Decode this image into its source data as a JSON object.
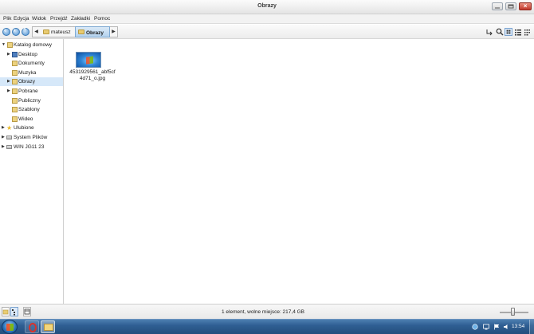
{
  "window": {
    "title": "Obrazy"
  },
  "menubar": [
    "Plik",
    "Edycja",
    "Widok",
    "Przejdź",
    "Zakładki",
    "Pomoc"
  ],
  "breadcrumb": {
    "parent": "mateusz",
    "current": "Obrazy"
  },
  "sidebar": {
    "items": [
      {
        "label": "Katalog domowy",
        "icon": "home-folder-icon",
        "expanded": true
      },
      {
        "label": "Desktop",
        "icon": "desktop-folder-icon",
        "expanded": false
      },
      {
        "label": "Dokumenty",
        "icon": "folder-icon"
      },
      {
        "label": "Muzyka",
        "icon": "folder-icon"
      },
      {
        "label": "Obrazy",
        "icon": "folder-icon",
        "selected": true,
        "expanded": false
      },
      {
        "label": "Pobrane",
        "icon": "folder-icon",
        "expanded": false
      },
      {
        "label": "Publiczny",
        "icon": "folder-icon"
      },
      {
        "label": "Szablony",
        "icon": "folder-icon"
      },
      {
        "label": "Wideo",
        "icon": "folder-icon"
      },
      {
        "label": "Ulubione",
        "icon": "star-icon",
        "expanded": false
      },
      {
        "label": "System Plików",
        "icon": "drive-icon",
        "expanded": false
      },
      {
        "label": "WIN JG11 23",
        "icon": "drive-icon",
        "expanded": false
      }
    ]
  },
  "files": [
    {
      "name": "4531929561_abf5cf4d71_o.jpg",
      "icon": "image-thumbnail"
    }
  ],
  "status": {
    "text": "1 element, wolne miejsce: 217,4 GB"
  },
  "taskbar": {
    "time": "13:54"
  },
  "colors": {
    "selection": "#d6e8f9",
    "taskbar": "#2f5f93",
    "close_button": "#c1372a"
  }
}
